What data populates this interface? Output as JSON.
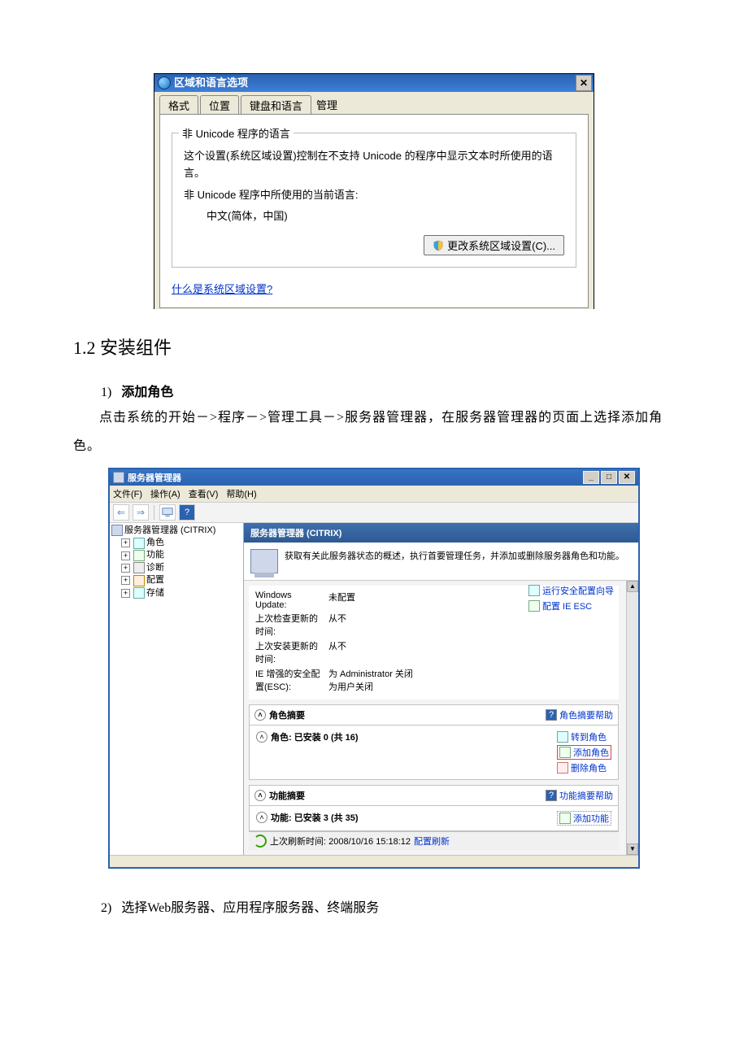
{
  "doc": {
    "section_title": "1.2 安装组件",
    "step1_num": "1)",
    "step1_label": "添加角色",
    "step1_text": "点击系统的开始－>程序－>管理工具－>服务器管理器，在服务器管理器的页面上选择添加角色。",
    "step2_num": "2)",
    "step2_label": "选择Web服务器、应用程序服务器、终端服务"
  },
  "dlg1": {
    "title": "区域和语言选项",
    "tabs": {
      "fmt": "格式",
      "loc": "位置",
      "kbd": "键盘和语言",
      "admin": "管理"
    },
    "fieldset_legend": "非 Unicode 程序的语言",
    "fs_desc": "这个设置(系统区域设置)控制在不支持 Unicode 的程序中显示文本时所使用的语言。",
    "cur_lang_label": "非 Unicode 程序中所使用的当前语言:",
    "cur_lang_value": "中文(简体，中国)",
    "change_btn": "更改系统区域设置(C)...",
    "link": "什么是系统区域设置?"
  },
  "sm": {
    "title": "服务器管理器",
    "menu": {
      "file": "文件(F)",
      "action": "操作(A)",
      "view": "查看(V)",
      "help": "帮助(H)"
    },
    "tree": {
      "root": "服务器管理器 (CITRIX)",
      "roles": "角色",
      "features": "功能",
      "diag": "诊断",
      "conf": "配置",
      "store": "存储"
    },
    "header": "服务器管理器 (CITRIX)",
    "desc": "获取有关此服务器状态的概述，执行首要管理任务，并添加或删除服务器角色和功能。",
    "info": {
      "winupdate_label": "Windows Update:",
      "winupdate_value": "未配置",
      "lastcheck_label": "上次检查更新的时间:",
      "lastcheck_value": "从不",
      "lastinstall_label": "上次安装更新的时间:",
      "lastinstall_value": "从不",
      "ieesc_label": "IE 增强的安全配置(ESC):",
      "ieesc_value1": "为 Administrator 关闭",
      "ieesc_value2": "为用户关闭"
    },
    "links": {
      "sec_wizard": "运行安全配置向导",
      "ieesc": "配置 IE ESC"
    },
    "role_sec": {
      "title": "角色摘要",
      "help": "角色摘要帮助",
      "installed": "角色: 已安装 0 (共 16)",
      "goto": "转到角色",
      "add": "添加角色",
      "del": "删除角色"
    },
    "feat_sec": {
      "title": "功能摘要",
      "help": "功能摘要帮助",
      "installed": "功能: 已安装 3 (共 35)",
      "add": "添加功能"
    },
    "footer": "上次刷新时间: 2008/10/16 15:18:12",
    "footer_link": "配置刷新"
  }
}
